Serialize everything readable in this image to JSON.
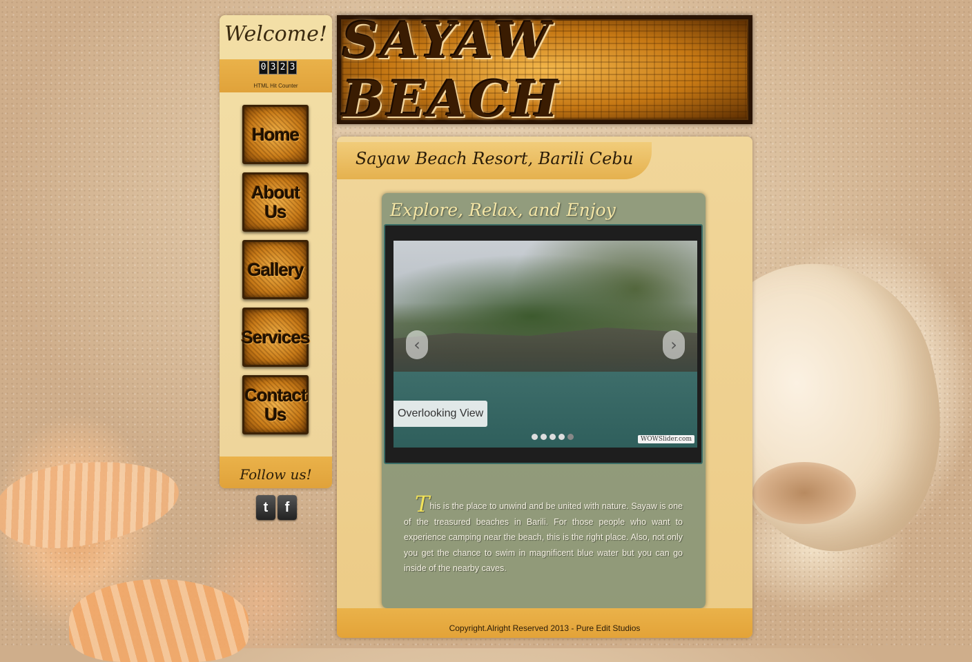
{
  "sidebar": {
    "welcome": "Welcome!",
    "hit_counter_digits": [
      "0",
      "3",
      "2",
      "3"
    ],
    "hit_counter_label": "HTML Hit Counter",
    "nav": [
      {
        "label": "Home"
      },
      {
        "label": "About Us"
      },
      {
        "label": "Gallery"
      },
      {
        "label": "Services"
      },
      {
        "label": "Contact Us"
      }
    ],
    "follow": "Follow us!",
    "social": [
      {
        "label": "t",
        "icon": "twitter-icon"
      },
      {
        "label": "f",
        "icon": "facebook-icon"
      }
    ]
  },
  "header": {
    "banner_title": "SAYAW BEACH"
  },
  "main": {
    "tab_title": "Sayaw Beach Resort, Barili Cebu",
    "box_title": "Explore, Relax, and Enjoy",
    "slider": {
      "caption": "Overlooking View",
      "prev_icon": "chevron-left-icon",
      "next_icon": "chevron-right-icon",
      "dots_total": 5,
      "active_dot": 4,
      "watermark": "WOWSlider.com"
    },
    "paragraph_dropcap": "T",
    "paragraph_rest": "his is the place to unwind and be united with nature. Sayaw is one of the treasured beaches in Barili. For those people who want to experience camping near the beach, this is the right place. Also, not only you get the chance to swim in magnificent blue water but you can go inside of the nearby caves.",
    "footer": "Copyright.Alright Reserved 2013 - Pure Edit Studios"
  }
}
